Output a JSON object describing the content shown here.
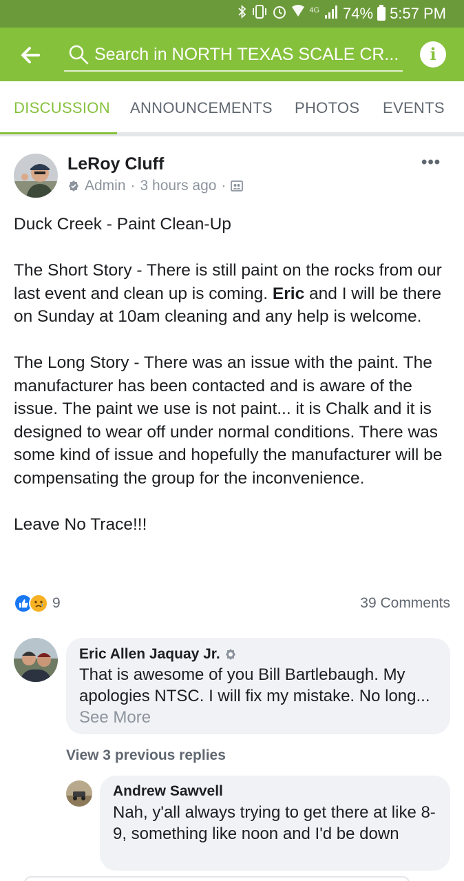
{
  "status_bar": {
    "network": "4G",
    "battery": "74%",
    "time": "5:57 PM",
    "icons": [
      "bluetooth-icon",
      "vibrate-icon",
      "alarm-icon",
      "wifi-icon",
      "signal-icon",
      "battery-icon"
    ]
  },
  "top_bar": {
    "search_text": "Search in NORTH TEXAS SCALE CR...",
    "colors": {
      "bar": "#86c13c",
      "status": "#6b9a3a"
    }
  },
  "tabs": [
    {
      "label": "DISCUSSION",
      "active": true
    },
    {
      "label": "ANNOUNCEMENTS",
      "active": false
    },
    {
      "label": "PHOTOS",
      "active": false
    },
    {
      "label": "EVENTS",
      "active": false
    }
  ],
  "post": {
    "author": "LeRoy Cluff",
    "role": "Admin",
    "time": "3 hours ago",
    "title": "Duck Creek - Paint Clean-Up",
    "short_story_before": "The Short Story - There is still paint on the rocks from our last event and clean up is coming. ",
    "short_story_mention": "Eric",
    "short_story_after": " and I will be there on Sunday at 10am cleaning and any help is welcome.",
    "long_story": "The Long Story - There was an issue with the paint. The manufacturer has been contacted and is aware of the issue. The paint we use is not paint... it is Chalk and it is designed to wear off under normal conditions. There was some kind of issue and hopefully the manufacturer will be compensating the group for the inconvenience.",
    "closing": "Leave No Trace!!!",
    "reaction_count": "9",
    "comment_count": "39 Comments"
  },
  "comments": [
    {
      "author": "Eric Allen Jaquay Jr.",
      "text": "That is awesome of you Bill Bartlebaugh. My apologies NTSC. I will fix my mistake. No long...",
      "see_more": "See More"
    }
  ],
  "view_previous": "View 3 previous replies",
  "replies": [
    {
      "author": "Andrew Sawvell",
      "text": "Nah, y'all always trying to get there at like 8-9, something like noon and I'd be down"
    }
  ]
}
